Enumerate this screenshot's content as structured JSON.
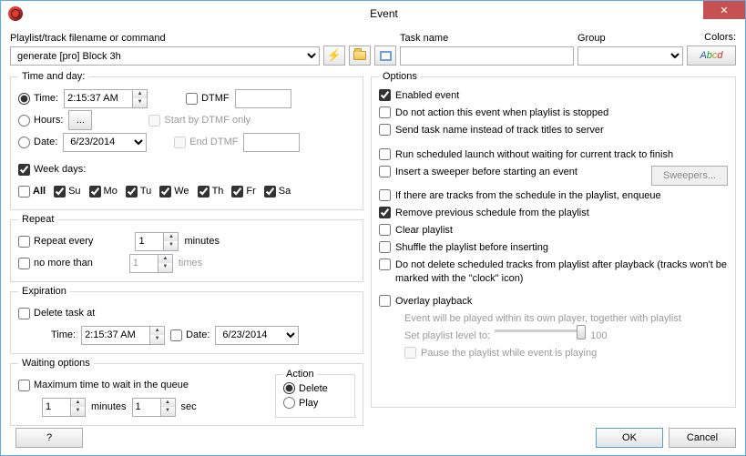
{
  "window": {
    "title": "Event"
  },
  "top": {
    "playlist_label": "Playlist/track filename or command",
    "playlist_value": "generate [pro] Block 3h",
    "task_label": "Task name",
    "task_value": "",
    "group_label": "Group",
    "group_value": "",
    "colors_label": "Colors:",
    "colors_btn": "Abcd"
  },
  "time_day": {
    "legend": "Time and day:",
    "time_label": "Time:",
    "time_value": "2:15:37 AM",
    "hours_label": "Hours:",
    "date_label": "Date:",
    "date_value": "6/23/2014",
    "dtmf": "DTMF",
    "start_dtmf": "Start by DTMF only",
    "end_dtmf": "End DTMF",
    "weekdays_label": "Week days:",
    "all": "All",
    "days": [
      "Su",
      "Mo",
      "Tu",
      "We",
      "Th",
      "Fr",
      "Sa"
    ]
  },
  "repeat": {
    "legend": "Repeat",
    "every": "Repeat every",
    "every_val": "1",
    "minutes": "minutes",
    "nomore": "no more than",
    "nomore_val": "1",
    "times": "times"
  },
  "expiration": {
    "legend": "Expiration",
    "delete": "Delete task at",
    "time_label": "Time:",
    "time_value": "2:15:37 AM",
    "date_label": "Date:",
    "date_value": "6/23/2014"
  },
  "waiting": {
    "legend": "Waiting options",
    "max": "Maximum time to wait in the queue",
    "min_val": "1",
    "minutes": "minutes",
    "sec_val": "1",
    "sec": "sec",
    "action": "Action",
    "delete": "Delete",
    "play": "Play"
  },
  "options": {
    "legend": "Options",
    "enabled": "Enabled event",
    "noaction": "Do not action this event when playlist is stopped",
    "sendtask": "Send task name instead of track titles to server",
    "runsched": "Run scheduled launch without waiting for current track to finish",
    "sweeper": "Insert a sweeper before starting an event",
    "sweepers_btn": "Sweepers...",
    "enqueue": "If there are tracks from the schedule in the playlist, enqueue",
    "removeprev": "Remove previous schedule from the playlist",
    "clear": "Clear playlist",
    "shuffle": "Shuffle the playlist before inserting",
    "nodelete": "Do not delete scheduled tracks from playlist after playback (tracks won't be marked with the \"clock\" icon)",
    "overlay": "Overlay playback",
    "overlay_hint": "Event will be played within its own player, together with playlist",
    "setlevel": "Set playlist level to:",
    "level_val": "100",
    "pause": "Pause the playlist while event is playing"
  },
  "footer": {
    "help": "?",
    "ok": "OK",
    "cancel": "Cancel"
  }
}
